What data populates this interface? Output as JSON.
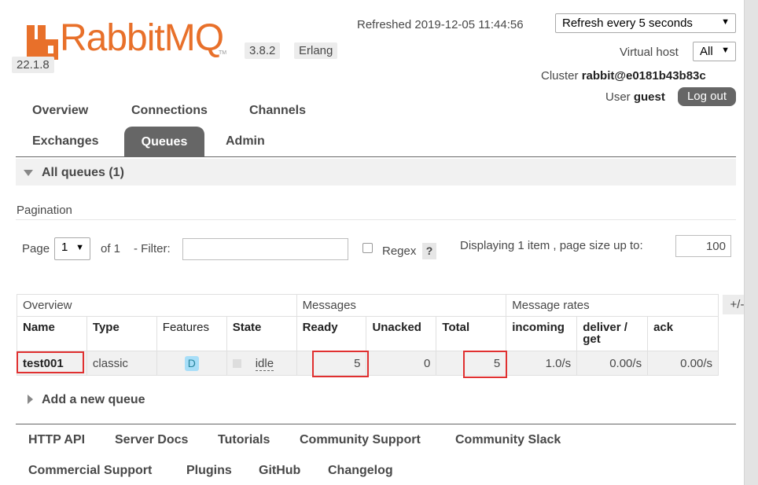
{
  "logo": {
    "word": "RabbitMQ",
    "tm": "TM"
  },
  "version": "3.8.2",
  "erlang_label": "Erlang",
  "erlang_version": "22.1.8",
  "header": {
    "refreshed": "Refreshed 2019-12-05 11:44:56",
    "refresh_select": "Refresh every 5 seconds",
    "vhost_label": "Virtual host",
    "vhost_select": "All",
    "cluster_label": "Cluster",
    "cluster_name": "rabbit@e0181b43b83c",
    "user_label": "User",
    "user_name": "guest",
    "logout": "Log out"
  },
  "nav": {
    "tabs": [
      "Overview",
      "Connections",
      "Channels",
      "Exchanges",
      "Queues",
      "Admin"
    ],
    "active": "Queues"
  },
  "section": {
    "title": "All queues (1)"
  },
  "pagination": {
    "label": "Pagination",
    "page_label": "Page",
    "page_value": "1",
    "of_label": "of 1",
    "filter_label": "- Filter:",
    "filter_value": "",
    "regex_label": "Regex",
    "help": "?",
    "displaying": "Displaying 1 item , page size up to:",
    "page_size": "100"
  },
  "table": {
    "groups": [
      "Overview",
      "Messages",
      "Message rates"
    ],
    "plus_minus": "+/-",
    "columns": [
      "Name",
      "Type",
      "Features",
      "State",
      "Ready",
      "Unacked",
      "Total",
      "incoming",
      "deliver / get",
      "ack"
    ],
    "rows": [
      {
        "name": "test001",
        "type": "classic",
        "feature": "D",
        "state": "idle",
        "ready": "5",
        "unacked": "0",
        "total": "5",
        "incoming": "1.0/s",
        "deliver_get": "0.00/s",
        "ack": "0.00/s"
      }
    ]
  },
  "add_queue": "Add a new queue",
  "footer": {
    "links": [
      "HTTP API",
      "Server Docs",
      "Tutorials",
      "Community Support",
      "Community Slack",
      "Commercial Support",
      "Plugins",
      "GitHub",
      "Changelog"
    ]
  },
  "colors": {
    "brand": "#e8702a",
    "tab_active": "#666666",
    "highlight": "#e03030",
    "feature_badge": "#a7def8"
  }
}
